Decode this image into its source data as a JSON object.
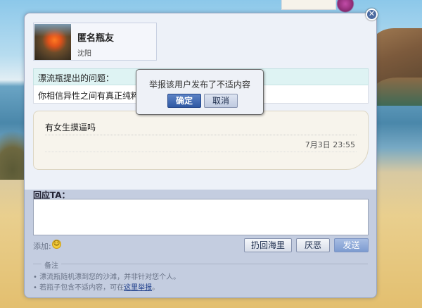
{
  "user": {
    "name": "匿名瓶友",
    "city": "沈阳"
  },
  "question": {
    "heading": "漂流瓶提出的问题：",
    "text": "你相信异性之间有真正纯粹的"
  },
  "answer": {
    "text": "有女生摸逼吗",
    "time": "7月3日 23:55"
  },
  "reply": {
    "label": "回应TA：",
    "add_label": "添加:"
  },
  "buttons": {
    "return": "扔回海里",
    "dislike": "厌恶",
    "send": "发送"
  },
  "notes": {
    "title": "备注",
    "line1": "• 漂流瓶随机漂到您的沙滩，并非针对您个人。",
    "line2_prefix": "• 若瓶子包含不适内容，可在",
    "line2_link": "这里举报",
    "line2_suffix": "。"
  },
  "popup": {
    "message": "举报该用户发布了不适内容",
    "ok": "确定",
    "cancel": "取消"
  },
  "icons": {
    "close": "close-icon",
    "smile": "smiley-icon"
  },
  "colors": {
    "accent": "#2f58a3",
    "dialog_bg": "#c4cde0",
    "question_bg": "#def3f3"
  }
}
